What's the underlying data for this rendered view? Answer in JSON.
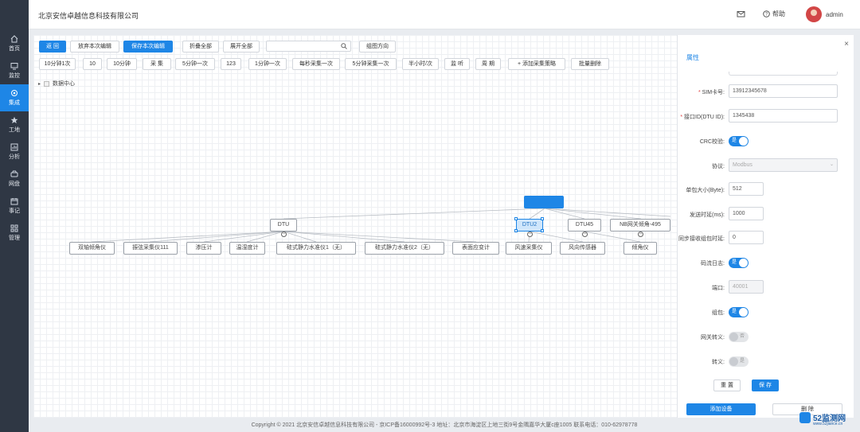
{
  "header": {
    "company": "北京安信卓越信息科技有限公司",
    "help": "帮助",
    "user": "admin"
  },
  "nav": [
    {
      "label": "首页",
      "icon": "home-icon"
    },
    {
      "label": "监控",
      "icon": "monitor-icon"
    },
    {
      "label": "集成",
      "icon": "integration-icon"
    },
    {
      "label": "工地",
      "icon": "star-icon"
    },
    {
      "label": "分析",
      "icon": "analysis-icon"
    },
    {
      "label": "网盘",
      "icon": "disk-icon"
    },
    {
      "label": "事记",
      "icon": "calendar-icon"
    },
    {
      "label": "管理",
      "icon": "grid-icon"
    }
  ],
  "toolbar": {
    "back": "返 回",
    "discard": "放弃本次编辑",
    "save_edit": "保存本次编辑",
    "collapse_all": "折叠全部",
    "expand_all": "展开全部",
    "search_placeholder": "",
    "direction": "组图方向"
  },
  "strategies": [
    "10分钟1次",
    "10",
    "10分钟",
    "采 集",
    "5分钟一次",
    "123",
    "1分钟一次",
    "每秒采集一次",
    "5分钟采集一次",
    "半小时/次",
    "监 听",
    "周 期",
    "添加采集策略",
    "批量删除"
  ],
  "tree": {
    "root_label": "数据中心"
  },
  "diagram": {
    "root": "",
    "dtu": "DTU",
    "dtu2": "DTU2",
    "dtu45": "DTU45",
    "nb": "NB网关倾角-495",
    "children_dtu": [
      "双轴倾角仪",
      "振弦采集仪111",
      "渗压计",
      "温湿度计",
      "硅式静力水准仪1（无）",
      "硅式静力水准仪2（无）",
      "表面应变计"
    ],
    "children_dtu2": [
      "风速采集仪",
      "风向传感器"
    ],
    "children_dtu45": [
      "倾角仪"
    ]
  },
  "panel": {
    "title": "属性",
    "sim_label": "SIM卡号:",
    "sim_value": "13912345678",
    "dtu_id_label": "接口ID(DTU ID):",
    "dtu_id_value": "1345438",
    "crc_label": "CRC校验:",
    "crc_on": "是",
    "protocol_label": "协议:",
    "protocol_value": "Modbus",
    "packet_label": "单包大小(Byte):",
    "packet_value": "512",
    "send_label": "发送时延(ms):",
    "send_value": "1000",
    "sync_label": "同步接收组包时延:",
    "sync_value": "0",
    "log_label": "码流日志:",
    "log_on": "是",
    "port_label": "端口:",
    "port_value": "40001",
    "pack_label": "组包:",
    "pack_on": "是",
    "gw_label": "网关转义:",
    "gw_off": "否",
    "esc_label": "转义:",
    "esc_off": "是",
    "reset": "重 置",
    "save": "保 存",
    "add_device": "添加设备",
    "delete": "删 除"
  },
  "footer": "Copyright © 2021 北京安信卓越信息科技有限公司 - 京ICP备16000992号-3 地址：北京市海淀区上地三街9号金隅嘉华大厦c座1005 联系电话：010-62978778",
  "watermark": {
    "brand": "52监测网",
    "url": "www.52jiance.cn"
  },
  "colors": {
    "accent": "#1e86e6",
    "sidebar": "#2f3744"
  }
}
